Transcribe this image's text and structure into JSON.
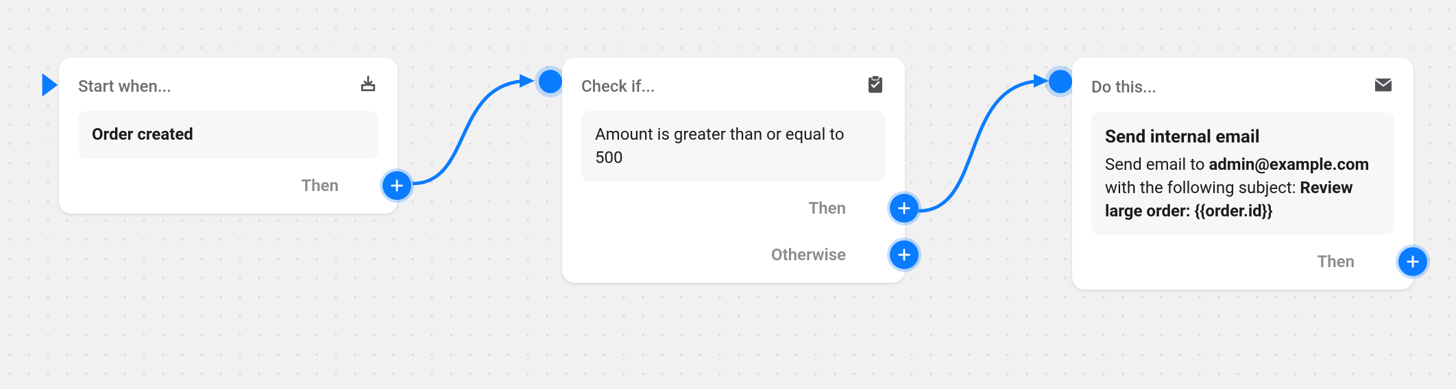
{
  "colors": {
    "accent": "#0a7cff",
    "muted": "#8a8a90",
    "text": "#1a1a1d"
  },
  "outlets": {
    "then": "Then",
    "otherwise": "Otherwise"
  },
  "nodes": {
    "trigger": {
      "header": "Start when...",
      "icon": "inbox-icon",
      "title": "Order created"
    },
    "condition": {
      "header": "Check if...",
      "icon": "checklist-icon",
      "text": "Amount is greater than or equal to 500"
    },
    "action": {
      "header": "Do this...",
      "icon": "mail-icon",
      "title": "Send internal email",
      "line1_pre": "Send email to ",
      "email": "admin@example.com",
      "line1_post": " with the following subject: ",
      "subject": "Review large order: {{order.id}}"
    }
  }
}
